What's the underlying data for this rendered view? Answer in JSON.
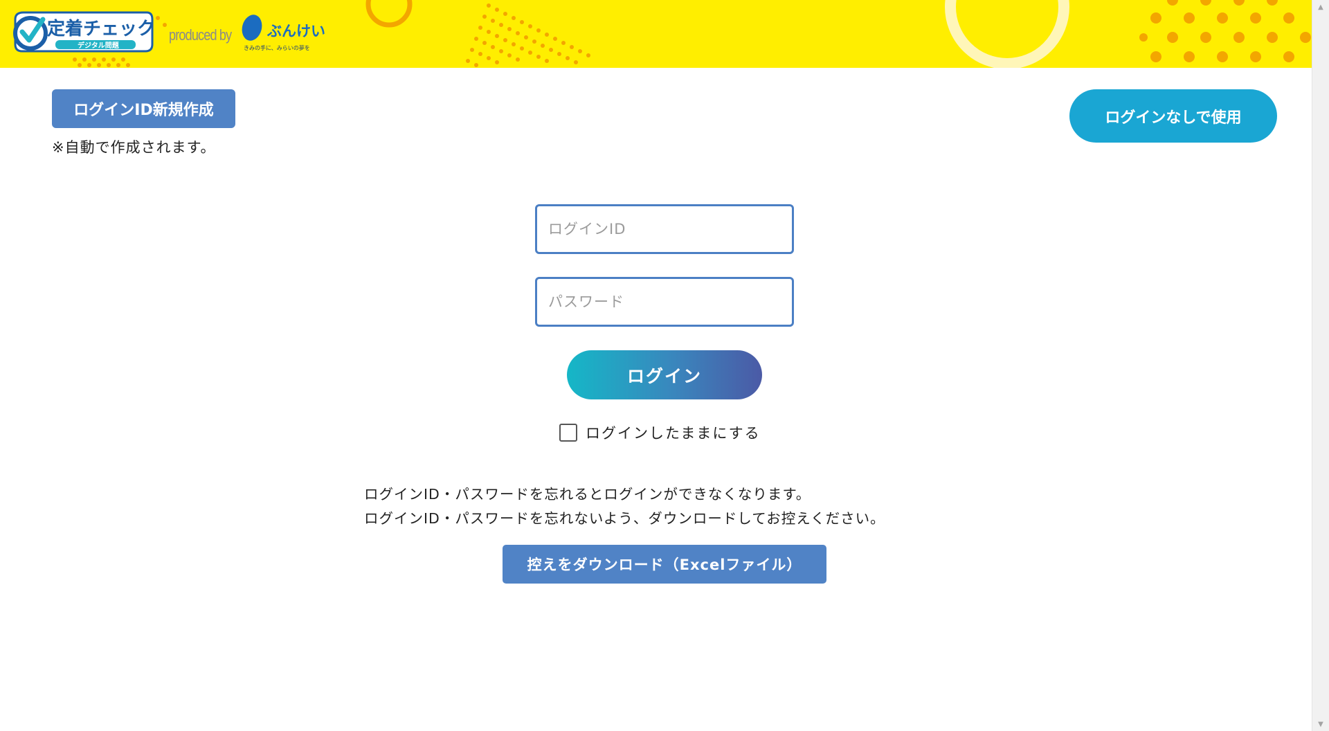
{
  "header": {
    "logo_text": "定着チェック",
    "logo_subtext": "デジタル問題",
    "produced_by": "produced by",
    "bunkei_name": "ぶんけい",
    "bunkei_tagline": "きみの手に、みらいの夢を",
    "background_color": "#ffee00"
  },
  "actions": {
    "new_id_label": "ログインID新規作成",
    "new_id_note": "※自動で作成されます。",
    "guest_label": "ログインなしで使用"
  },
  "form": {
    "login_id_placeholder": "ログインID",
    "password_placeholder": "パスワード",
    "login_button": "ログイン",
    "remember_label": "ログインしたままにする",
    "remember_checked": false
  },
  "notice": {
    "line1": "ログインID・パスワードを忘れるとログインができなくなります。",
    "line2": "ログインID・パスワードを忘れないよう、ダウンロードしてお控えください。",
    "download_button": "控えをダウンロード（Excelファイル）"
  },
  "scrollbar": {
    "up_icon": "▲",
    "down_icon": "▼"
  },
  "colors": {
    "primary_button": "#5083c6",
    "guest_button": "#1aa6d3",
    "login_gradient_start": "#15b7c7",
    "login_gradient_end": "#4b5aa6",
    "input_border": "#4b7fc4"
  }
}
